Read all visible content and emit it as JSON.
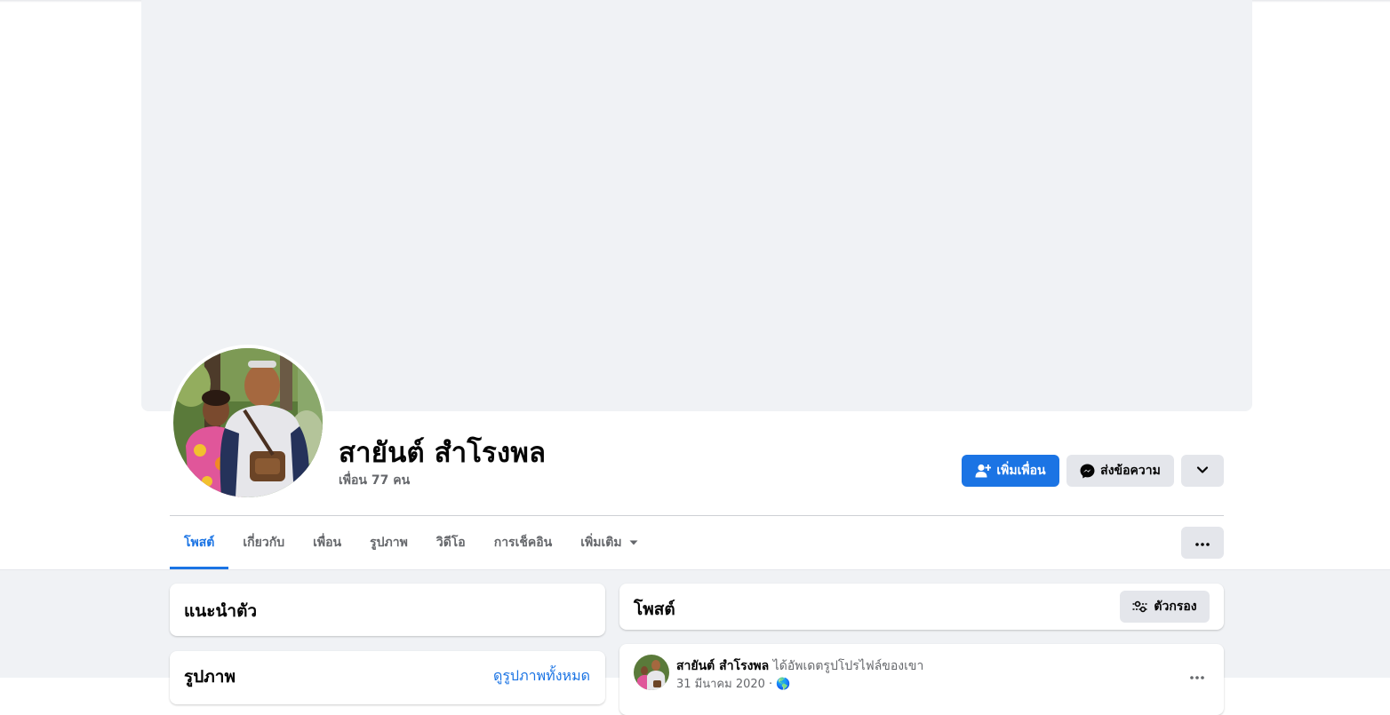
{
  "profile": {
    "name": "สายันต์ สำโรงพล",
    "friend_count": "เพื่อน 77 คน"
  },
  "actions": {
    "add_friend_label": "เพิ่มเพื่อน",
    "message_label": "ส่งข้อความ"
  },
  "tabs": [
    {
      "label": "โพสต์",
      "active": true
    },
    {
      "label": "เกี่ยวกับ",
      "active": false
    },
    {
      "label": "เพื่อน",
      "active": false
    },
    {
      "label": "รูปภาพ",
      "active": false
    },
    {
      "label": "วิดีโอ",
      "active": false
    },
    {
      "label": "การเช็คอิน",
      "active": false
    },
    {
      "label": "เพิ่มเติม",
      "active": false
    }
  ],
  "intro": {
    "title": "แนะนำตัว"
  },
  "photos": {
    "title": "รูปภาพ",
    "see_all_label": "ดูรูปภาพทั้งหมด"
  },
  "posts": {
    "title": "โพสต์",
    "filter_label": "ตัวกรอง"
  },
  "post": {
    "author": "สายันต์ สำโรงพล",
    "action": "ได้อัพเดตรูปโปรไฟล์ของเขา",
    "meta": "31 มีนาคม 2020 · 🌎"
  },
  "colors": {
    "accent": "#1b74e4",
    "page_bg": "#f0f2f5",
    "secondary_button": "#e4e6eb",
    "muted_text": "#65676b"
  },
  "icons": {
    "add_friend": "person-plus-icon",
    "message": "messenger-icon",
    "dropdown": "chevron-down-icon",
    "more": "ellipsis-icon",
    "filter": "sliders-icon",
    "tab_caret": "caret-down-icon"
  }
}
